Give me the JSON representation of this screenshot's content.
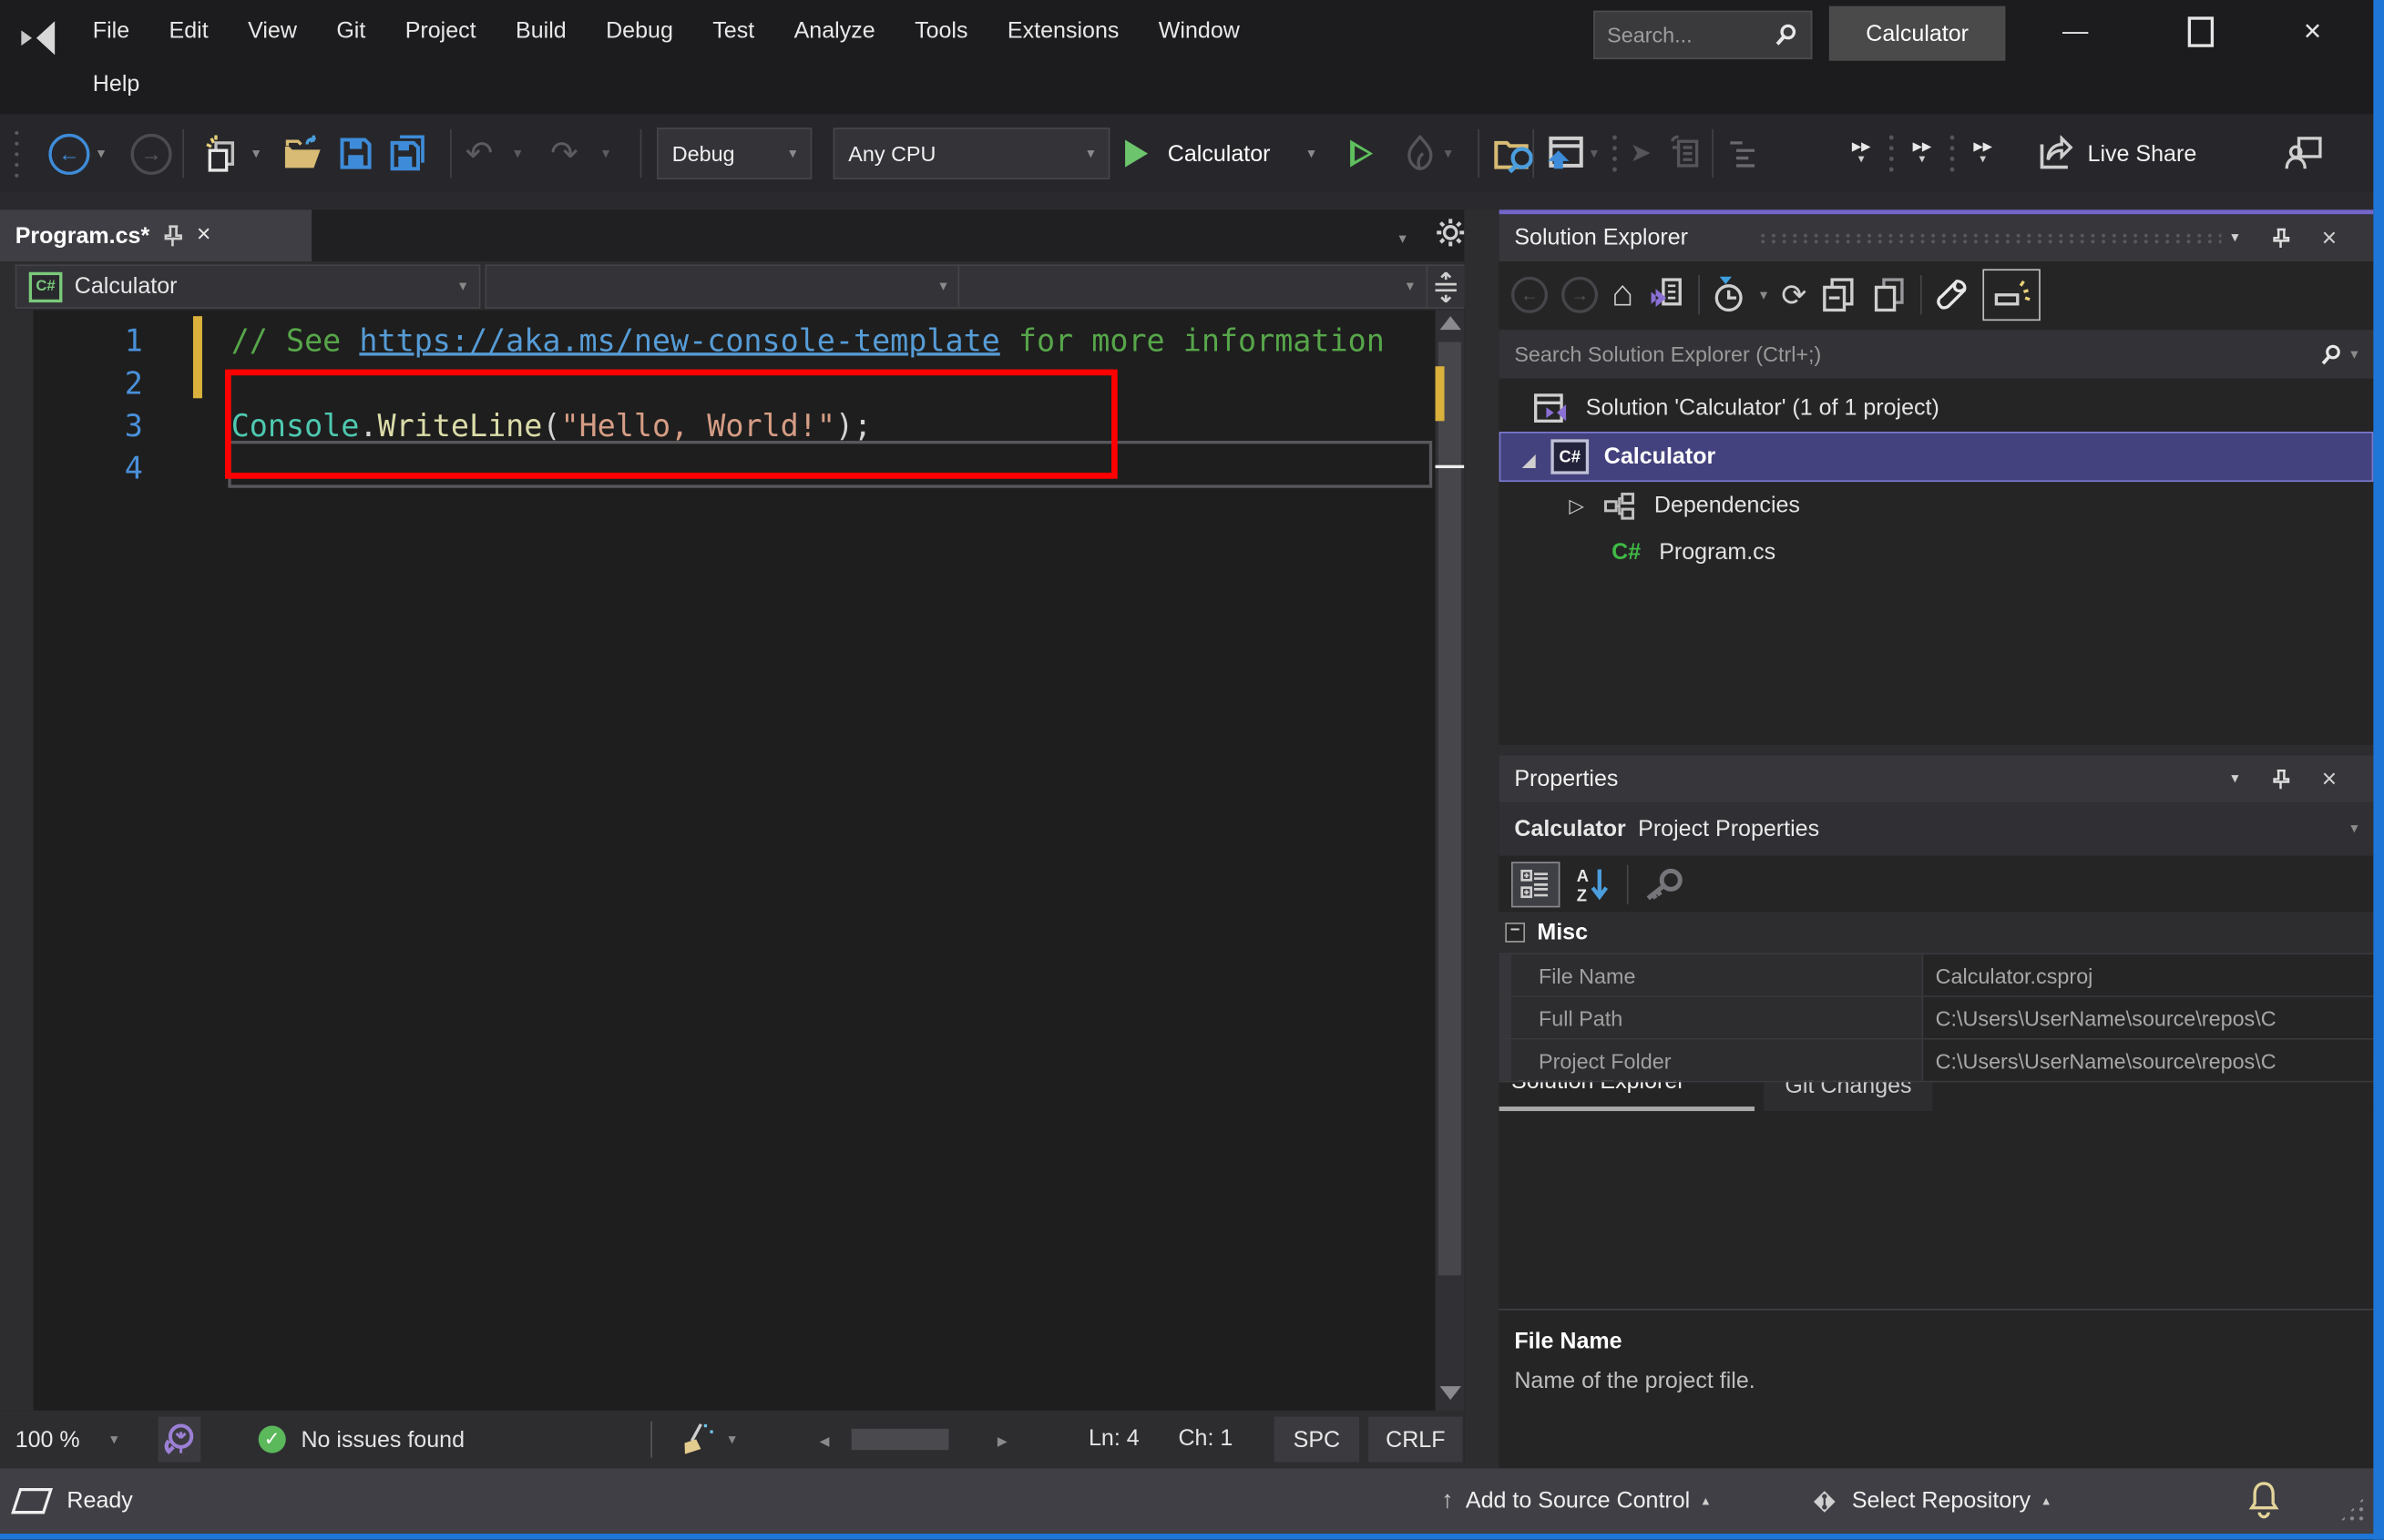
{
  "window": {
    "menus": [
      "File",
      "Edit",
      "View",
      "Git",
      "Project",
      "Build",
      "Debug",
      "Test",
      "Analyze",
      "Tools",
      "Extensions",
      "Window"
    ],
    "menu_help": "Help",
    "search_placeholder": "Search...",
    "solution_button": "Calculator"
  },
  "toolbar": {
    "configuration": "Debug",
    "platform": "Any CPU",
    "run_target": "Calculator",
    "live_share": "Live Share"
  },
  "editor": {
    "tab": "Program.cs*",
    "navbar_project": "Calculator",
    "line_numbers": [
      "1",
      "2",
      "3",
      "4"
    ],
    "code": {
      "l1": [
        {
          "t": "// See "
        },
        {
          "t": "https://aka.ms/new-console-template"
        },
        {
          "t": " for more information"
        }
      ],
      "l3": [
        {
          "t": "Console"
        },
        {
          "t": "."
        },
        {
          "t": "WriteLine"
        },
        {
          "t": "("
        },
        {
          "t": "\"Hello, World!\""
        },
        {
          "t": ");"
        }
      ]
    },
    "status": {
      "zoom": "100 %",
      "health": "No issues found",
      "line": "Ln: 4",
      "column": "Ch: 1",
      "spaces": "SPC",
      "line_endings": "CRLF"
    }
  },
  "solution_explorer": {
    "title": "Solution Explorer",
    "search_placeholder": "Search Solution Explorer (Ctrl+;)",
    "solution_label": "Solution 'Calculator' (1 of 1 project)",
    "project_label": "Calculator",
    "project_icon": "C#",
    "dependencies_label": "Dependencies",
    "file_label": "Program.cs",
    "file_icon": "C#",
    "tabs": [
      "Solution Explorer",
      "Git Changes"
    ]
  },
  "properties": {
    "title": "Properties",
    "object_name": "Calculator",
    "object_type": "Project Properties",
    "category": "Misc",
    "rows": [
      {
        "name": "File Name",
        "value": "Calculator.csproj"
      },
      {
        "name": "Full Path",
        "value": "C:\\Users\\UserName\\source\\repos\\C"
      },
      {
        "name": "Project Folder",
        "value": "C:\\Users\\UserName\\source\\repos\\C"
      }
    ],
    "description_title": "File Name",
    "description_text": "Name of the project file."
  },
  "statusbar": {
    "ready": "Ready",
    "add_to_source_control": "Add to Source Control",
    "select_repository": "Select Repository"
  },
  "colors": {
    "window_accent_blue": "#1e76d6",
    "panel_accent_purple": "#7266cb",
    "selection_purple": "#44427e",
    "annotation_red": "#ff0000",
    "comment_green": "#57a64a",
    "link_blue": "#569cd6",
    "type_teal": "#4ec9b0",
    "method_yellow": "#dcdcaa",
    "string_salmon": "#d69d85",
    "line_number_blue": "#4a90d9",
    "modified_yellow": "#d9b13b",
    "health_green": "#5bb85b"
  }
}
